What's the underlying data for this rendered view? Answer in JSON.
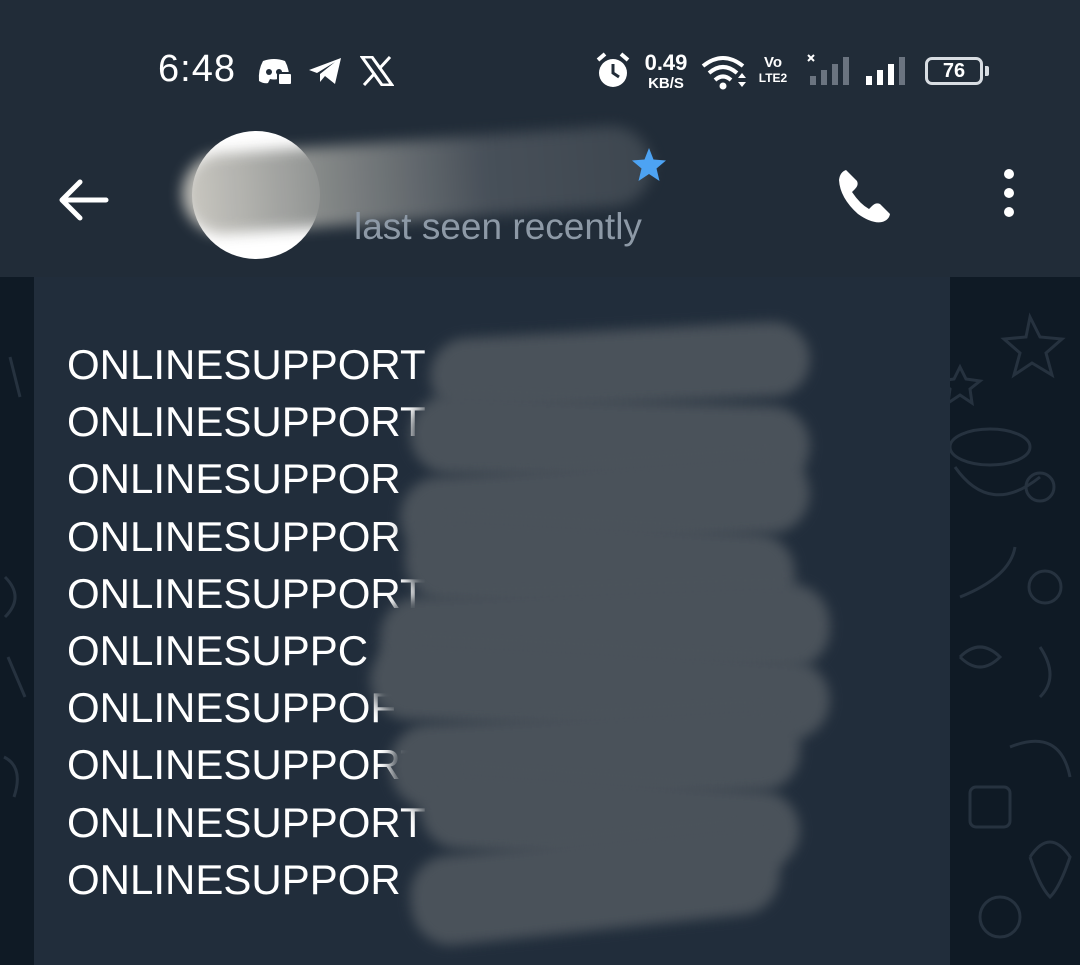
{
  "status_bar": {
    "time": "6:48",
    "notification_icons": [
      "discord-icon",
      "telegram-icon",
      "x-icon"
    ],
    "status_icons": [
      "alarm-icon",
      "wifi-icon",
      "volte-icon",
      "signal-sim1-icon",
      "signal-sim2-icon",
      "battery-icon"
    ],
    "network_speed_value": "0.49",
    "network_speed_unit": "KB/S",
    "volte_top": "Vo",
    "volte_bottom": "LTE2",
    "battery_level": "76"
  },
  "header": {
    "back_icon": "arrow-left-icon",
    "contact_name": "",
    "verified_icon": "star-icon",
    "status": "last seen recently",
    "call_icon": "phone-icon",
    "menu_icon": "more-vertical-icon"
  },
  "message": {
    "lines": [
      "ONLINESUPPORT",
      "ONLINESUPPORT",
      "ONLINESUPPOR",
      "ONLINESUPPOR",
      "ONLINESUPPORT",
      "ONLINESUPPC",
      "ONLINESUPPOF",
      "ONLINESUPPORT",
      "ONLINESUPPORT",
      "ONLINESUPPOR"
    ],
    "redacted": true
  },
  "colors": {
    "header_bg": "#212c38",
    "chat_bg": "#0f1a25",
    "bubble_bg": "#212d3b",
    "accent_star": "#4da3f3",
    "status_text": "#8d99a6"
  }
}
